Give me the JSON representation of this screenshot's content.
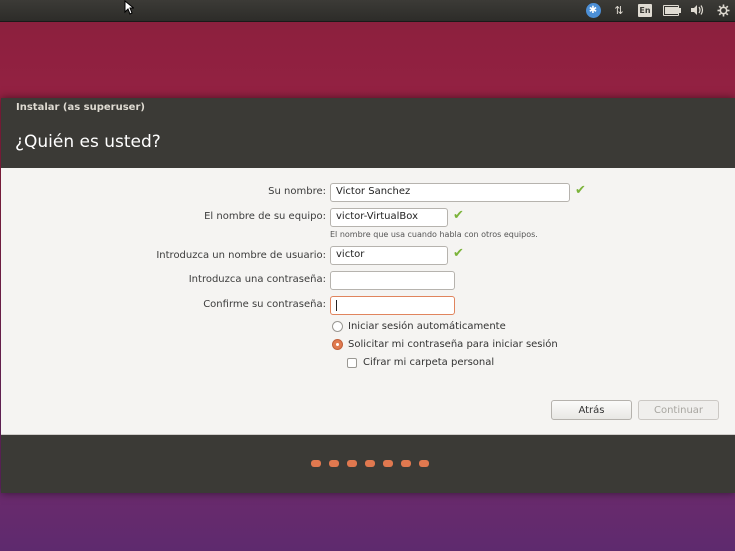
{
  "topbar": {
    "language": "En",
    "icons": [
      "cursor-arrow-icon",
      "accessibility-icon",
      "network-arrows-icon",
      "keyboard-language-icon",
      "battery-icon",
      "volume-icon",
      "system-gear-icon"
    ]
  },
  "window": {
    "title": "Instalar (as superuser)",
    "page_title": "¿Quién es usted?"
  },
  "form": {
    "name_label": "Su nombre:",
    "name_value": "Victor Sanchez",
    "computer_label": "El nombre de su equipo:",
    "computer_value": "victor-VirtualBox",
    "computer_hint": "El nombre que usa cuando habla con otros equipos.",
    "username_label": "Introduzca un nombre de usuario:",
    "username_value": "victor",
    "password_label": "Introduzca una contraseña:",
    "password_value": "",
    "confirm_label": "Confirme su contraseña:",
    "confirm_value": "",
    "check_mark": "✔"
  },
  "options": {
    "auto_login": "Iniciar sesión automáticamente",
    "require_password": "Solicitar mi contraseña para iniciar sesión",
    "encrypt_home": "Cifrar mi carpeta personal",
    "selected": "require_password",
    "encrypt_checked": false
  },
  "buttons": {
    "back": "Atrás",
    "continue": "Continuar"
  },
  "progress": {
    "steps": 7
  },
  "colors": {
    "accent": "#e07a4f",
    "valid_check": "#7bb33a",
    "header_bg": "#3b3a36"
  }
}
